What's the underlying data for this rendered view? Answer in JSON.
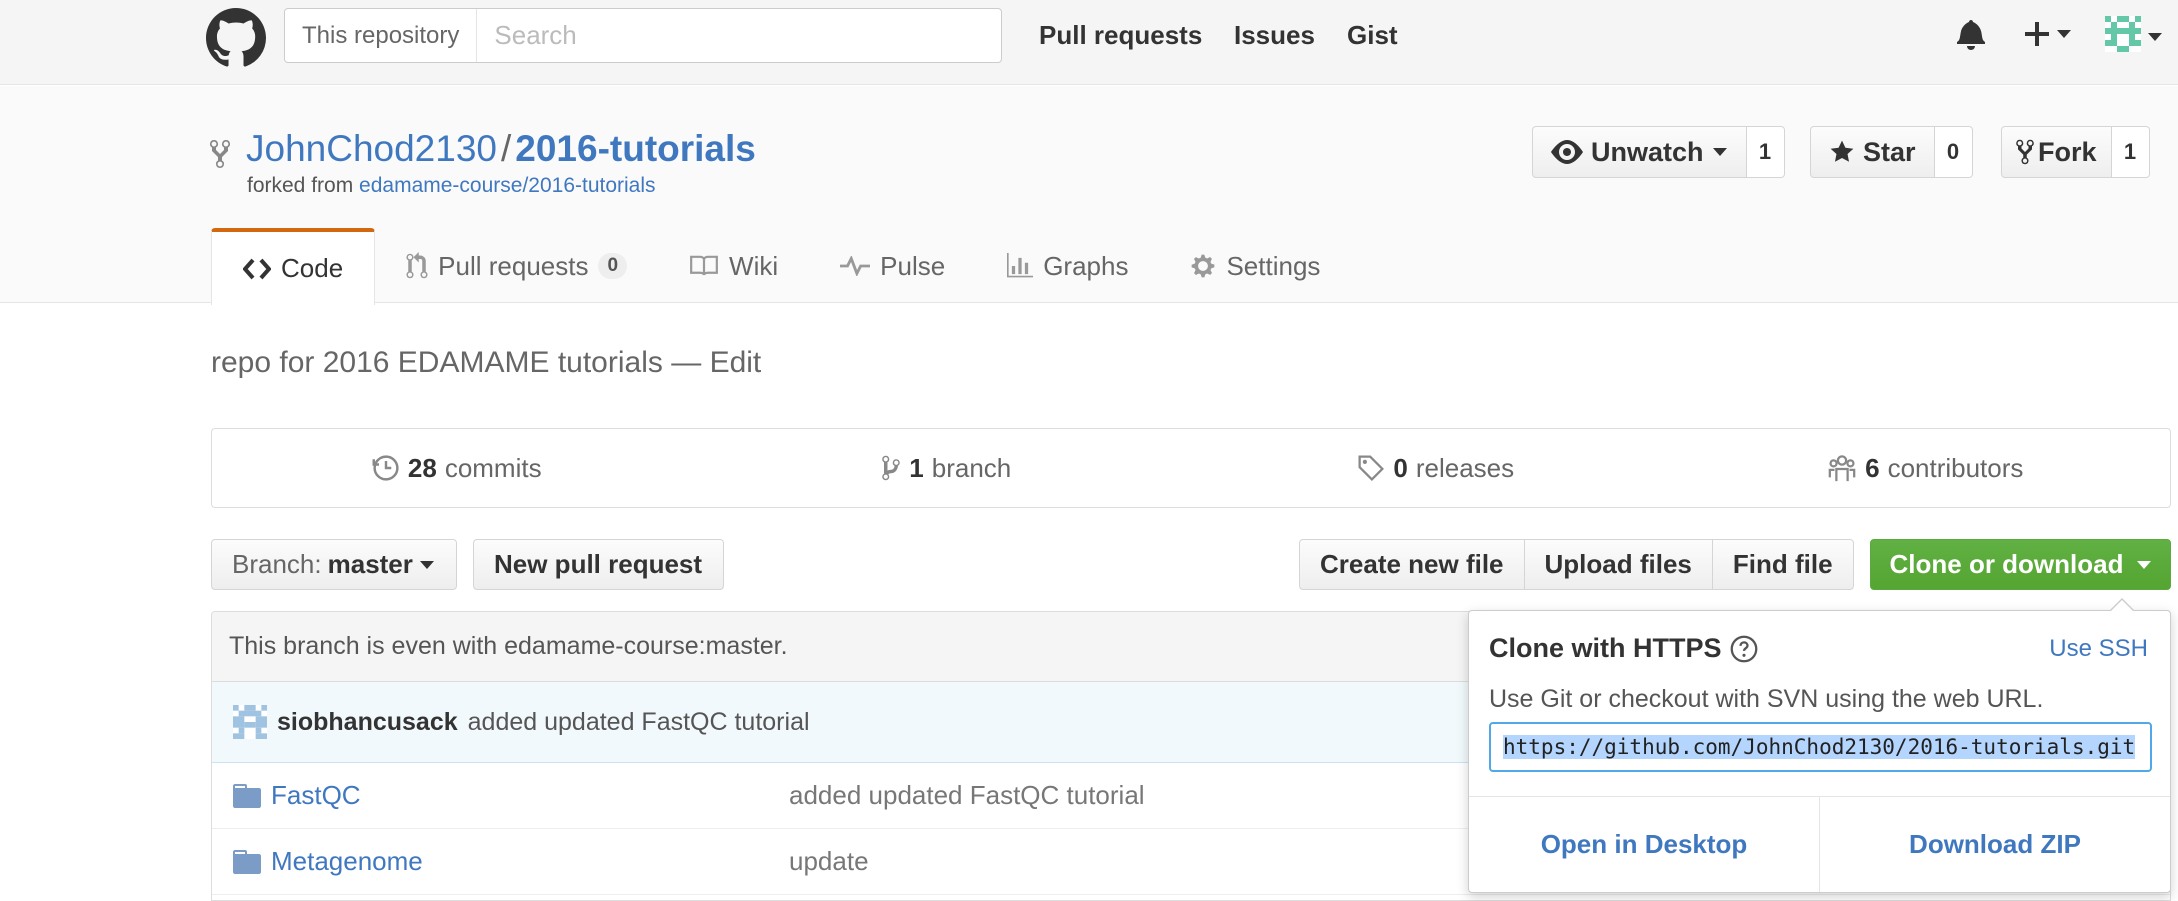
{
  "header": {
    "search_scope": "This repository",
    "search_placeholder": "Search",
    "nav": [
      "Pull requests",
      "Issues",
      "Gist"
    ]
  },
  "repo": {
    "owner": "JohnChod2130",
    "separator": "/",
    "name": "2016-tutorials",
    "forked_prefix": "forked from",
    "forked_source": "edamame-course/2016-tutorials",
    "watch": {
      "label": "Unwatch",
      "count": "1"
    },
    "star": {
      "label": "Star",
      "count": "0"
    },
    "fork": {
      "label": "Fork",
      "count": "1"
    }
  },
  "tabs": {
    "code": "Code",
    "pull_requests": "Pull requests",
    "pull_requests_count": "0",
    "wiki": "Wiki",
    "pulse": "Pulse",
    "graphs": "Graphs",
    "settings": "Settings"
  },
  "description": {
    "text": "repo for 2016 EDAMAME tutorials",
    "dash": "—",
    "edit": "Edit"
  },
  "numbers": {
    "commits_count": "28",
    "commits_label": "commits",
    "branch_count": "1",
    "branch_label": "branch",
    "releases_count": "0",
    "releases_label": "releases",
    "contributors_count": "6",
    "contributors_label": "contributors"
  },
  "filebar": {
    "branch_prefix": "Branch:",
    "branch_name": "master",
    "new_pr": "New pull request",
    "create_file": "Create new file",
    "upload_files": "Upload files",
    "find_file": "Find file",
    "clone": "Clone or download"
  },
  "filelist": {
    "even_status": "This branch is even with edamame-course:master.",
    "commit_author": "siobhancusack",
    "commit_message": "added updated FastQC tutorial",
    "files": [
      {
        "name": "FastQC",
        "message": "added updated FastQC tutorial"
      },
      {
        "name": "Metagenome",
        "message": "update"
      }
    ]
  },
  "clone_menu": {
    "title": "Clone with HTTPS",
    "use_ssh": "Use SSH",
    "help": "Use Git or checkout with SVN using the web URL.",
    "url": "https://github.com/JohnChod2130/2016-tutorials.git",
    "open_desktop": "Open in Desktop",
    "download_zip": "Download ZIP"
  },
  "colors": {
    "link": "#4078c0",
    "clone_green": "#55a532",
    "tab_accent": "#d26911"
  }
}
